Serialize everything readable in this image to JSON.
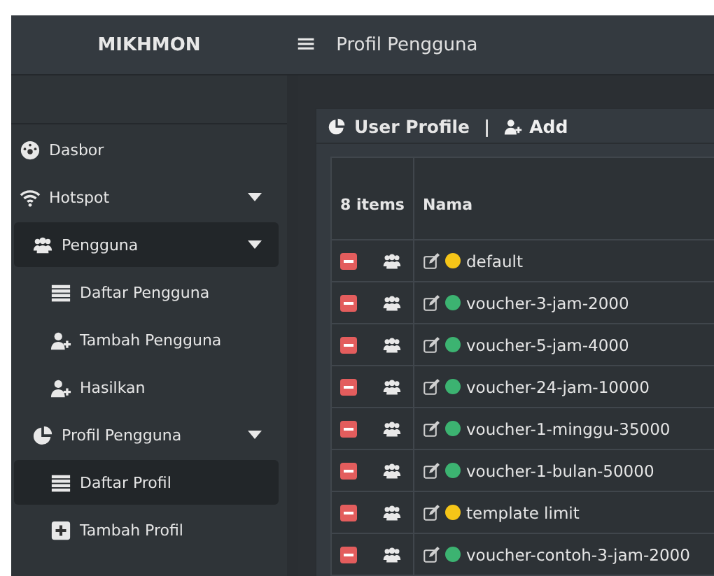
{
  "topbar": {
    "brand": "MIKHMON",
    "menu_icon": "≡",
    "title": "Profil Pengguna"
  },
  "sidebar": {
    "items": [
      {
        "label": "Dasbor",
        "selected": false
      },
      {
        "label": "Hotspot",
        "selected": false,
        "expanded": true,
        "children": [
          {
            "label": "Pengguna",
            "selected": true,
            "expanded": true,
            "children": [
              {
                "label": "Daftar Pengguna",
                "selected": false
              },
              {
                "label": "Tambah Pengguna",
                "selected": false
              },
              {
                "label": "Hasilkan",
                "selected": false
              }
            ]
          },
          {
            "label": "Profil Pengguna",
            "selected": false,
            "expanded": true,
            "children": [
              {
                "label": "Daftar Profil",
                "selected": true
              },
              {
                "label": "Tambah Profil",
                "selected": false
              }
            ]
          }
        ]
      }
    ]
  },
  "panel": {
    "title": "User Profile",
    "separator": "|",
    "add_label": "Add",
    "table": {
      "count": "8 items",
      "columns": [
        "Nama"
      ],
      "rows": [
        {
          "name": "default",
          "color": "#f5c518"
        },
        {
          "name": "voucher-3-jam-2000",
          "color": "#3cb371"
        },
        {
          "name": "voucher-5-jam-4000",
          "color": "#3cb371"
        },
        {
          "name": "voucher-24-jam-10000",
          "color": "#3cb371"
        },
        {
          "name": "voucher-1-minggu-35000",
          "color": "#3cb371"
        },
        {
          "name": "voucher-1-bulan-50000",
          "color": "#3cb371"
        },
        {
          "name": "template limit",
          "color": "#f5c518"
        },
        {
          "name": "voucher-contoh-3-jam-2000",
          "color": "#3cb371"
        }
      ]
    }
  }
}
